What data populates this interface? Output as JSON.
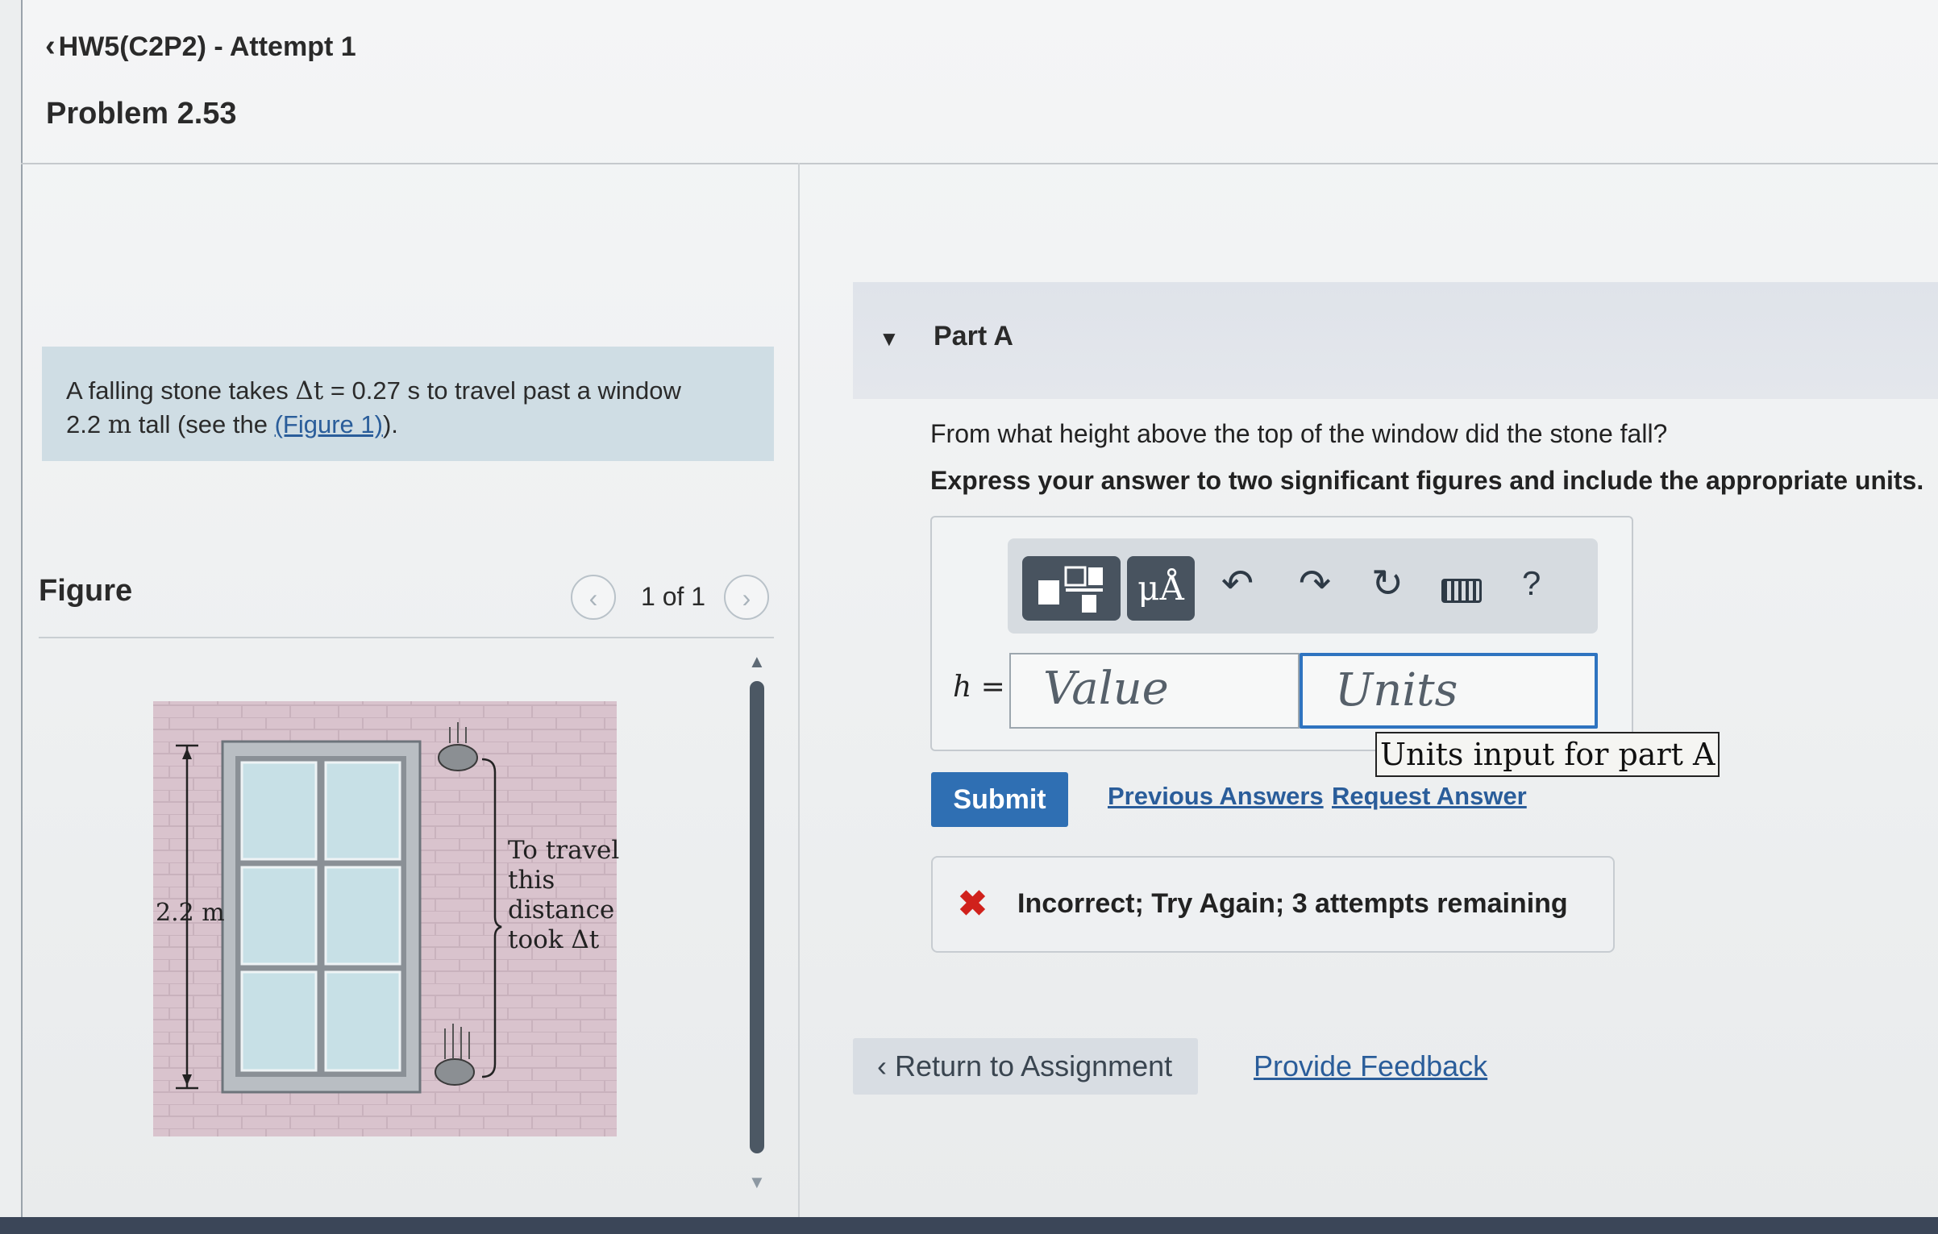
{
  "header": {
    "back_label": "HW5(C2P2) - Attempt 1",
    "problem_title": "Problem 2.53"
  },
  "problem": {
    "text_part1": "A falling stone takes ",
    "delta_t_symbol": "Δt",
    "text_part2": " = 0.27 s to travel past a window",
    "text_part3": "2.2 ",
    "unit_m": "m",
    "text_part4": " tall (see the ",
    "figure_link": "(Figure 1)",
    "text_part5": ")."
  },
  "figure": {
    "label": "Figure",
    "counter": "1 of 1",
    "height_label": "2.2 m",
    "annotation": [
      "To travel",
      "this",
      "distance",
      "took  Δt"
    ]
  },
  "part_a": {
    "title": "Part A",
    "question": "From what height above the top of the window did the stone fall?",
    "instruction": "Express your answer to two significant figures and include the appropriate units.",
    "variable": "h =",
    "toolbar_units_label": "μÅ",
    "help_label": "?",
    "value_placeholder": "Value",
    "units_placeholder": "Units",
    "units_tooltip": "Units input for part A",
    "submit_label": "Submit",
    "previous_answers": "Previous Answers",
    "request_answer": "Request Answer",
    "feedback": "Incorrect; Try Again; 3 attempts remaining"
  },
  "footer": {
    "return_label": "Return to Assignment",
    "feedback_link": "Provide Feedback"
  },
  "colors": {
    "submit": "#2f6fb3",
    "error": "#d0211c",
    "link": "#2a5d9a",
    "problem_box": "#cfdde4"
  }
}
